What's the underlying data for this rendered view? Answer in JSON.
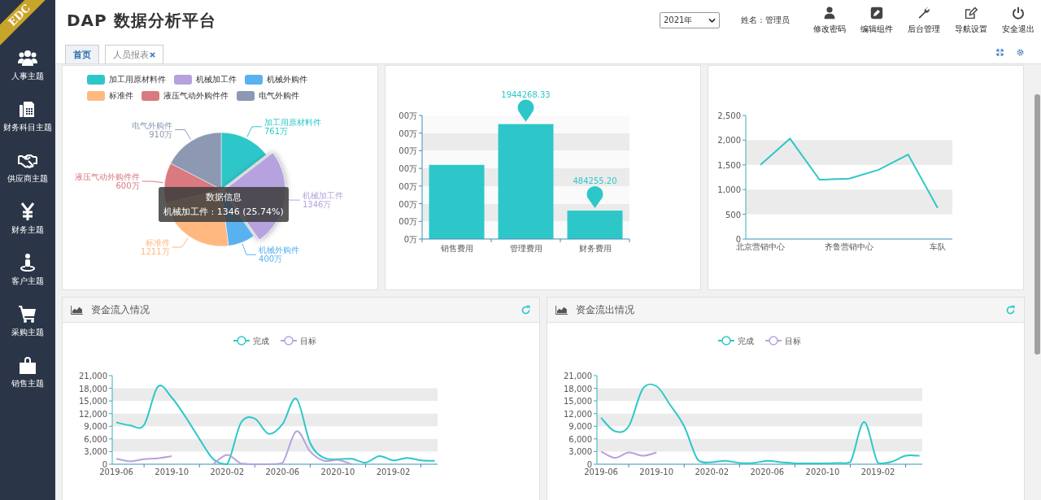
{
  "brand": "EDC",
  "sidebar": {
    "items": [
      {
        "label": "人事主题"
      },
      {
        "label": "财务科目主题"
      },
      {
        "label": "供应商主题"
      },
      {
        "label": "财务主题"
      },
      {
        "label": "客户主题"
      },
      {
        "label": "采购主题"
      },
      {
        "label": "销售主题"
      }
    ]
  },
  "header": {
    "title": "DAP 数据分析平台",
    "year_select": "2021年",
    "user": "姓名：管理员",
    "actions": [
      {
        "label": "修改密码"
      },
      {
        "label": "编辑组件"
      },
      {
        "label": "后台管理"
      },
      {
        "label": "导航设置"
      },
      {
        "label": "安全退出"
      }
    ]
  },
  "tabs": [
    {
      "label": "首页",
      "selected": true,
      "closable": false
    },
    {
      "label": "人员报表",
      "selected": false,
      "closable": true
    }
  ],
  "pie_panel": {
    "legend": [
      {
        "label": "加工用原材料件",
        "color": "#2ec7c9"
      },
      {
        "label": "机械加工件",
        "color": "#b6a2de"
      },
      {
        "label": "机械外购件",
        "color": "#5ab1ef"
      },
      {
        "label": "标准件",
        "color": "#ffb980"
      },
      {
        "label": "液压气动外购件件",
        "color": "#d87a80"
      },
      {
        "label": "电气外购件",
        "color": "#8d98b3"
      }
    ],
    "slices": [
      {
        "value": "761万",
        "highlighted": false
      },
      {
        "value": "1346万",
        "highlighted": true
      },
      {
        "value": "400万",
        "highlighted": false
      },
      {
        "value": "1211万",
        "highlighted": false
      },
      {
        "value": "600万",
        "highlighted": false
      },
      {
        "value": "910万",
        "highlighted": false
      }
    ],
    "chart_data": {
      "type": "pie",
      "categories": [
        "加工用原材料件",
        "机械加工件",
        "机械外购件",
        "标准件",
        "液压气动外购件件",
        "电气外购件"
      ],
      "values": [
        14.56,
        25.74,
        7.65,
        23.16,
        11.48,
        17.41
      ]
    },
    "tooltip": {
      "title": "数据信息",
      "text": "机械加工件 : 1346 (25.74%)"
    }
  },
  "bar_panel": {
    "y_labels": [
      "00万",
      "00万",
      "00万",
      "00万",
      "00万",
      "00万",
      "00万",
      "0万"
    ],
    "categories": [
      "销售费用",
      "管理费用",
      "财务费用"
    ],
    "pin_labels": [
      "1944268.33",
      "484255.20"
    ]
  },
  "line_panel": {
    "chart_data": {
      "type": "line",
      "categories": [
        "北京营销中心",
        null,
        null,
        "齐鲁营销中心",
        null,
        null,
        "车队"
      ],
      "series": [
        {
          "color": "#2ec7c9",
          "values": [
            1500,
            2030,
            1200,
            1220,
            1400,
            1710,
            630
          ]
        }
      ],
      "ylim": [
        0,
        2500
      ],
      "yticks": [
        {
          "value": 0,
          "label": "0"
        },
        {
          "value": 500,
          "label": "500"
        },
        {
          "value": 1000,
          "label": "1,000"
        },
        {
          "value": 1500,
          "label": "1,500"
        },
        {
          "value": 2000,
          "label": "2,000"
        },
        {
          "value": 2500,
          "label": "2,500"
        }
      ]
    }
  },
  "bottom_panels": [
    {
      "title": "资金流入情况",
      "chart_data": {
        "type": "line",
        "legend": "top",
        "categories": [
          "2019-06",
          null,
          null,
          null,
          "2019-10",
          null,
          null,
          null,
          "2020-02",
          null,
          null,
          null,
          "2020-06",
          null,
          null,
          null,
          "2020-10",
          null,
          null,
          null,
          "2019-02",
          null,
          null,
          null
        ],
        "series": [
          {
            "name": "完成",
            "color": "#2ec7c9",
            "values": [
              9900,
              9200,
              9300,
              18400,
              15800,
              11200,
              6000,
              1200,
              0,
              9800,
              10800,
              7200,
              9500,
              15500,
              5000,
              1500,
              1200,
              1300,
              400,
              1900,
              900,
              1500,
              900,
              800
            ]
          },
          {
            "name": "目标",
            "color": "#b6a2de",
            "values": [
              1300,
              700,
              1200,
              1400,
              1900,
              null,
              null,
              0,
              2200,
              200,
              0,
              0,
              300,
              7800,
              3000,
              800,
              1000,
              0,
              null,
              null,
              null,
              null,
              null,
              null
            ]
          }
        ],
        "ylim": [
          0,
          21000
        ],
        "yticks": [
          {
            "value": 0,
            "label": "0"
          },
          {
            "value": 3000,
            "label": "3,000"
          },
          {
            "value": 6000,
            "label": "6,000"
          },
          {
            "value": 9000,
            "label": "9,000"
          },
          {
            "value": 12000,
            "label": "12,000"
          },
          {
            "value": 15000,
            "label": "15,000"
          },
          {
            "value": 18000,
            "label": "18,000"
          },
          {
            "value": 21000,
            "label": "21,000"
          }
        ]
      }
    },
    {
      "title": "资金流出情况",
      "chart_data": {
        "type": "line",
        "legend": "top",
        "categories": [
          "2019-06",
          null,
          null,
          null,
          "2019-10",
          null,
          null,
          null,
          "2020-02",
          null,
          null,
          null,
          "2020-06",
          null,
          null,
          null,
          "2020-10",
          null,
          null,
          null,
          "2019-02",
          null,
          null,
          null
        ],
        "series": [
          {
            "name": "完成",
            "color": "#2ec7c9",
            "values": [
              11000,
              7800,
              9000,
              17800,
              18500,
              14000,
              9000,
              1000,
              500,
              800,
              300,
              300,
              800,
              500,
              200,
              200,
              200,
              300,
              500,
              10000,
              300,
              600,
              2000,
              2000
            ]
          },
          {
            "name": "目标",
            "color": "#b6a2de",
            "values": [
              3000,
              1500,
              2800,
              2000,
              2800,
              null,
              null,
              null,
              null,
              null,
              null,
              null,
              null,
              null,
              null,
              null,
              null,
              null,
              null,
              null,
              null,
              null,
              null,
              null
            ]
          }
        ],
        "ylim": [
          0,
          21000
        ],
        "yticks": [
          {
            "value": 0,
            "label": "0"
          },
          {
            "value": 3000,
            "label": "3,000"
          },
          {
            "value": 6000,
            "label": "6,000"
          },
          {
            "value": 9000,
            "label": "9,000"
          },
          {
            "value": 12000,
            "label": "12,000"
          },
          {
            "value": 15000,
            "label": "15,000"
          },
          {
            "value": 18000,
            "label": "18,000"
          },
          {
            "value": 21000,
            "label": "21,000"
          }
        ]
      }
    }
  ]
}
